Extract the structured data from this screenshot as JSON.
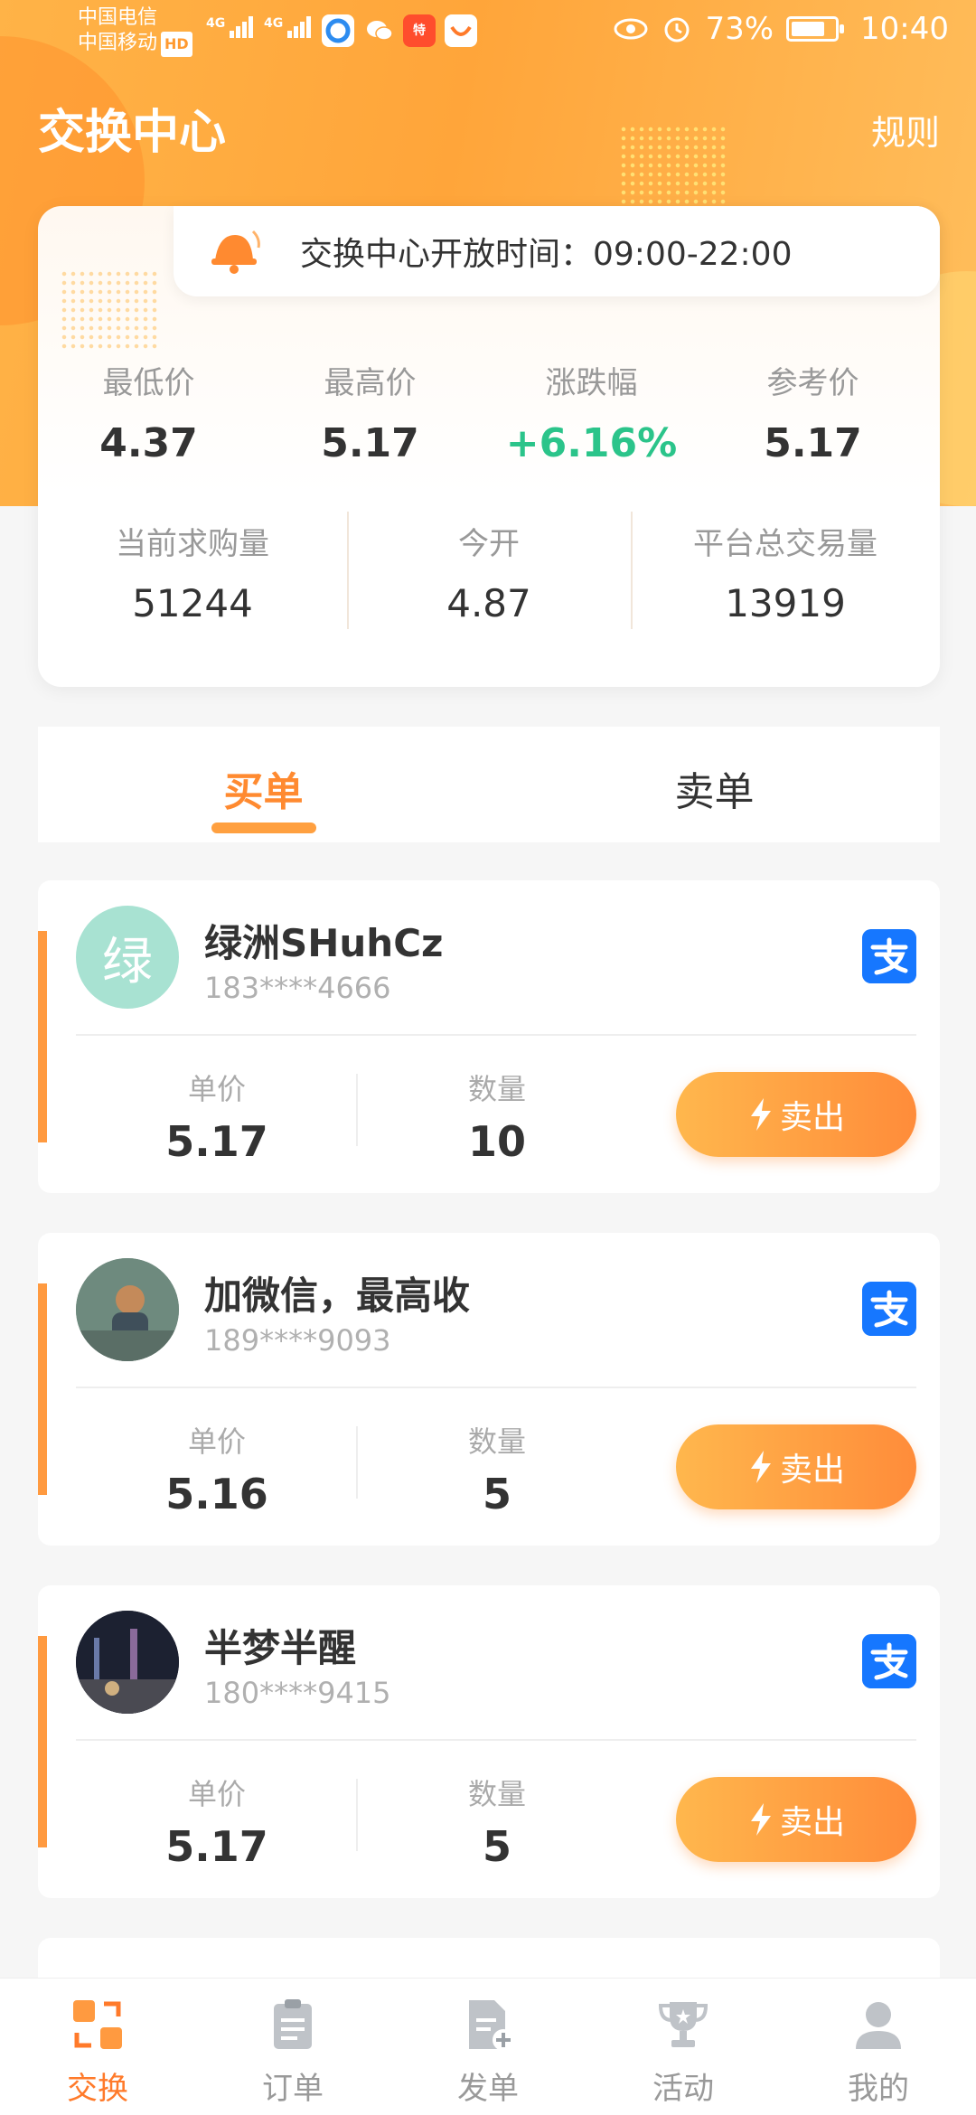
{
  "status_bar": {
    "carrier1": "中国电信",
    "carrier2": "中国移动",
    "hd": "HD",
    "net1": "4G",
    "net2": "4G",
    "battery": "73%",
    "time": "10:40"
  },
  "header": {
    "title": "交换中心",
    "rules": "规则"
  },
  "notice": "交换中心开放时间：09:00-22:00",
  "stats_row1": [
    {
      "label": "最低价",
      "value": "4.37"
    },
    {
      "label": "最高价",
      "value": "5.17"
    },
    {
      "label": "涨跌幅",
      "value": "+6.16%"
    },
    {
      "label": "参考价",
      "value": "5.17"
    }
  ],
  "stats_row2": [
    {
      "label": "当前求购量",
      "value": "51244"
    },
    {
      "label": "今开",
      "value": "4.87"
    },
    {
      "label": "平台总交易量",
      "value": "13919"
    }
  ],
  "tabs": [
    {
      "label": "买单",
      "active": true
    },
    {
      "label": "卖单",
      "active": false
    }
  ],
  "orders": [
    {
      "avatar_text": "绿",
      "name": "绿洲SHuhCz",
      "phone": "183****4666",
      "price_label": "单价",
      "price": "5.17",
      "qty_label": "数量",
      "qty": "10",
      "button": "卖出",
      "payment_icon": "alipay-icon"
    },
    {
      "avatar_text": "",
      "name": "加微信，最高收",
      "phone": "189****9093",
      "price_label": "单价",
      "price": "5.16",
      "qty_label": "数量",
      "qty": "5",
      "button": "卖出",
      "payment_icon": "alipay-icon"
    },
    {
      "avatar_text": "",
      "name": "半梦半醒",
      "phone": "180****9415",
      "price_label": "单价",
      "price": "5.17",
      "qty_label": "数量",
      "qty": "5",
      "button": "卖出",
      "payment_icon": "alipay-icon"
    }
  ],
  "bottom_nav": [
    {
      "label": "交换",
      "icon": "exchange-icon",
      "active": true
    },
    {
      "label": "订单",
      "icon": "clipboard-icon",
      "active": false
    },
    {
      "label": "发单",
      "icon": "new-order-icon",
      "active": false
    },
    {
      "label": "活动",
      "icon": "trophy-icon",
      "active": false
    },
    {
      "label": "我的",
      "icon": "user-icon",
      "active": false
    }
  ],
  "colors": {
    "accent": "#ff8a30",
    "up": "#2bc48a",
    "alipay": "#1677ff"
  }
}
